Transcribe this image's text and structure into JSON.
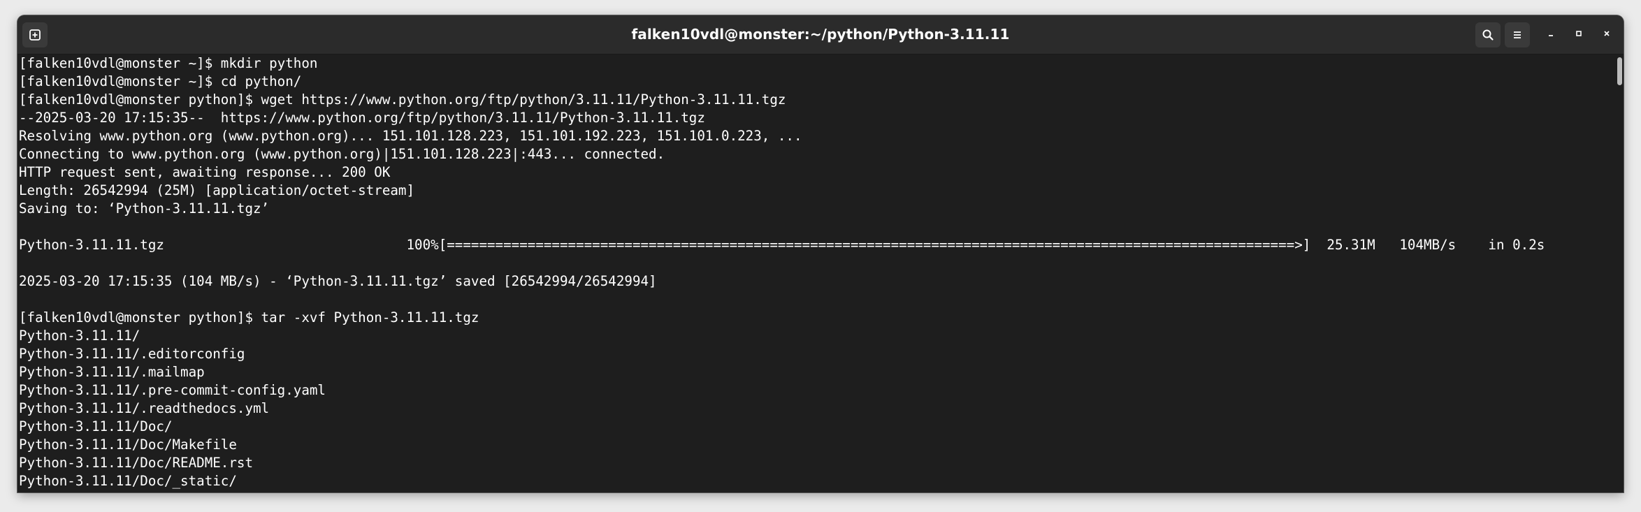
{
  "window": {
    "title": "falken10vdl@monster:~/python/Python-3.11.11"
  },
  "titlebar": {
    "new_tab_icon": "new-tab-icon",
    "search_icon": "search-icon",
    "menu_icon": "hamburger-menu-icon",
    "minimize_icon": "minimize-icon",
    "maximize_icon": "maximize-icon",
    "close_icon": "close-icon"
  },
  "colors": {
    "terminal_bg": "#1e1e1e",
    "titlebar_bg": "#2b2b2b",
    "text": "#ffffff"
  },
  "terminal": {
    "lines": [
      "[falken10vdl@monster ~]$ mkdir python",
      "[falken10vdl@monster ~]$ cd python/",
      "[falken10vdl@monster python]$ wget https://www.python.org/ftp/python/3.11.11/Python-3.11.11.tgz",
      "--2025-03-20 17:15:35--  https://www.python.org/ftp/python/3.11.11/Python-3.11.11.tgz",
      "Resolving www.python.org (www.python.org)... 151.101.128.223, 151.101.192.223, 151.101.0.223, ...",
      "Connecting to www.python.org (www.python.org)|151.101.128.223|:443... connected.",
      "HTTP request sent, awaiting response... 200 OK",
      "Length: 26542994 (25M) [application/octet-stream]",
      "Saving to: ‘Python-3.11.11.tgz’",
      "",
      "Python-3.11.11.tgz                              100%[=========================================================================================================>]  25.31M   104MB/s    in 0.2s",
      "",
      "2025-03-20 17:15:35 (104 MB/s) - ‘Python-3.11.11.tgz’ saved [26542994/26542994]",
      "",
      "[falken10vdl@monster python]$ tar -xvf Python-3.11.11.tgz",
      "Python-3.11.11/",
      "Python-3.11.11/.editorconfig",
      "Python-3.11.11/.mailmap",
      "Python-3.11.11/.pre-commit-config.yaml",
      "Python-3.11.11/.readthedocs.yml",
      "Python-3.11.11/Doc/",
      "Python-3.11.11/Doc/Makefile",
      "Python-3.11.11/Doc/README.rst",
      "Python-3.11.11/Doc/_static/"
    ]
  }
}
